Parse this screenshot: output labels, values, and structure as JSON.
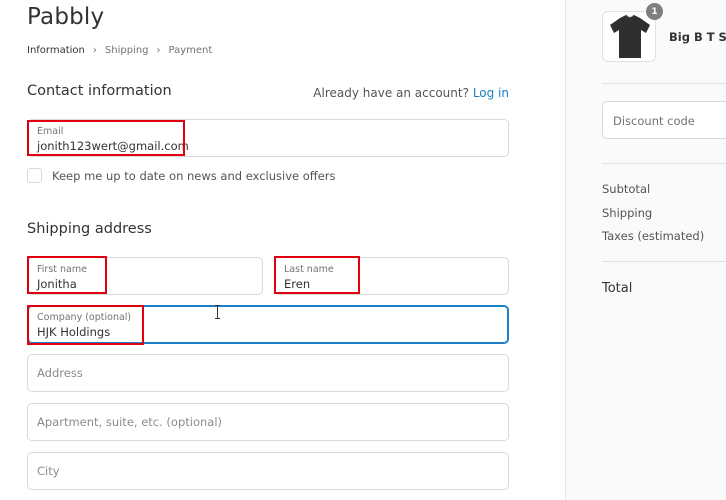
{
  "brand": {
    "name": "Pabbly"
  },
  "breadcrumb": {
    "items": [
      "Information",
      "Shipping",
      "Payment"
    ],
    "separator": "›"
  },
  "contact": {
    "title": "Contact information",
    "have_account_text": "Already have an account?",
    "login_label": "Log in",
    "email": {
      "label": "Email",
      "value": "jonith123wert@gmail.com"
    },
    "newsletter_label": "Keep me up to date on news and exclusive offers"
  },
  "shipping": {
    "title": "Shipping address",
    "first_name": {
      "label": "First name",
      "value": "Jonitha"
    },
    "last_name": {
      "label": "Last name",
      "value": "Eren"
    },
    "company": {
      "label": "Company (optional)",
      "value": "HJK Holdings"
    },
    "address_placeholder": "Address",
    "apartment_placeholder": "Apartment, suite, etc. (optional)",
    "city_placeholder": "City"
  },
  "summary": {
    "quantity": "1",
    "product_name": "Big B T Shi",
    "discount_placeholder": "Discount code",
    "subtotal_label": "Subtotal",
    "shipping_label": "Shipping",
    "taxes_label": "Taxes (estimated)",
    "total_label": "Total"
  },
  "colors": {
    "accent": "#1b7fc9",
    "highlight_box": "#e0000f",
    "panel_bg": "#fafafa"
  }
}
